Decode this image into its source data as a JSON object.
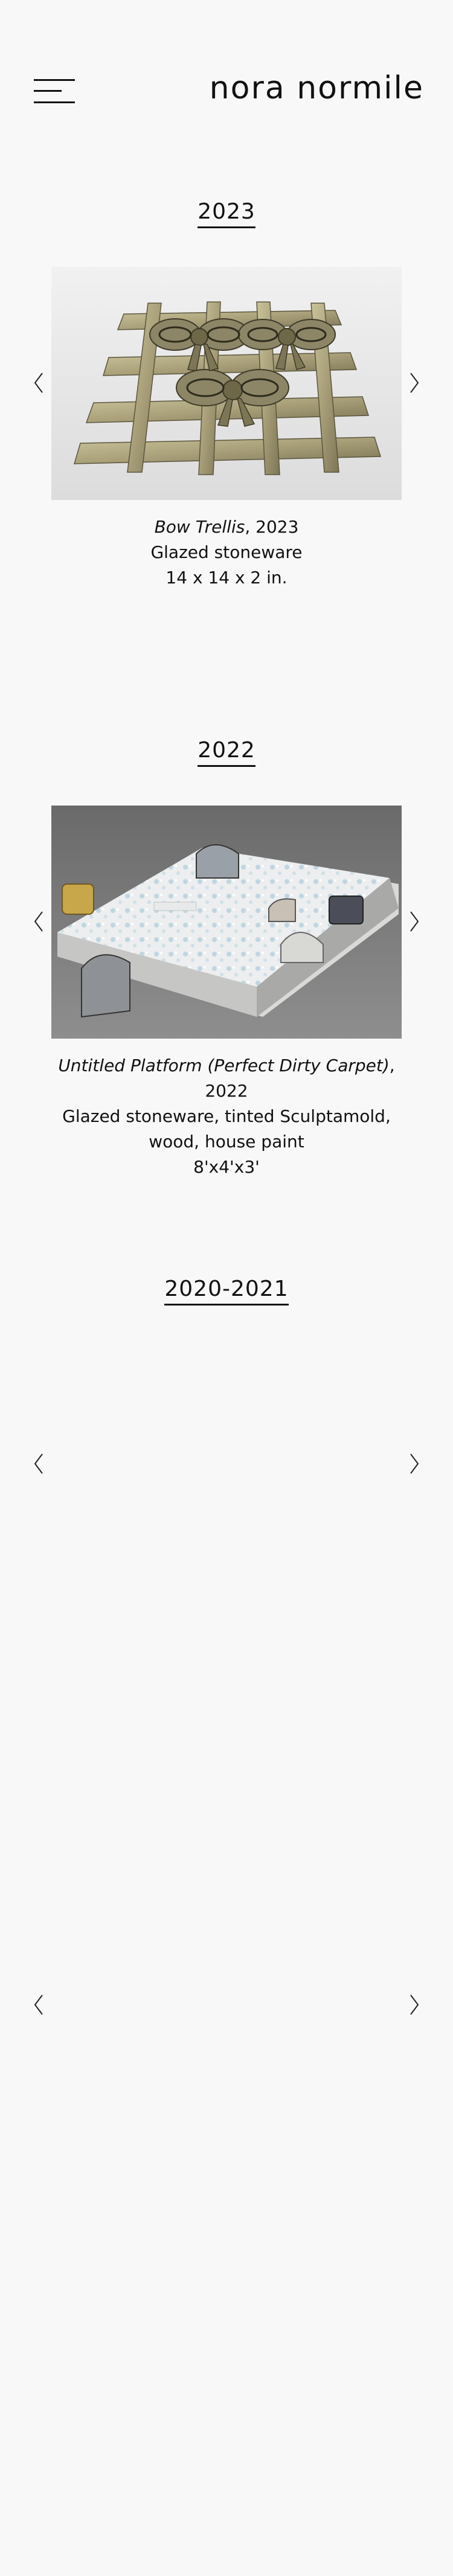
{
  "header": {
    "logo": "nora normile",
    "menu_icon": "hamburger-menu-icon"
  },
  "sections": [
    {
      "year": "2023",
      "caption": {
        "title": "Bow Trellis",
        "title_suffix": ", 2023",
        "line2": "Glazed stoneware",
        "line3": "14 x 14 x 2 in."
      }
    },
    {
      "year": "2022",
      "caption": {
        "title": "Untitled Platform (Perfect Dirty Carpet)",
        "title_suffix": ",",
        "line2": "2022",
        "line3": "Glazed stoneware, tinted Sculptamold,",
        "line4": "wood, house paint",
        "line5": "8'x4'x3'"
      }
    },
    {
      "year": "2020-2021"
    }
  ],
  "icons": {
    "prev": "chevron-left-icon",
    "next": "chevron-right-icon"
  }
}
